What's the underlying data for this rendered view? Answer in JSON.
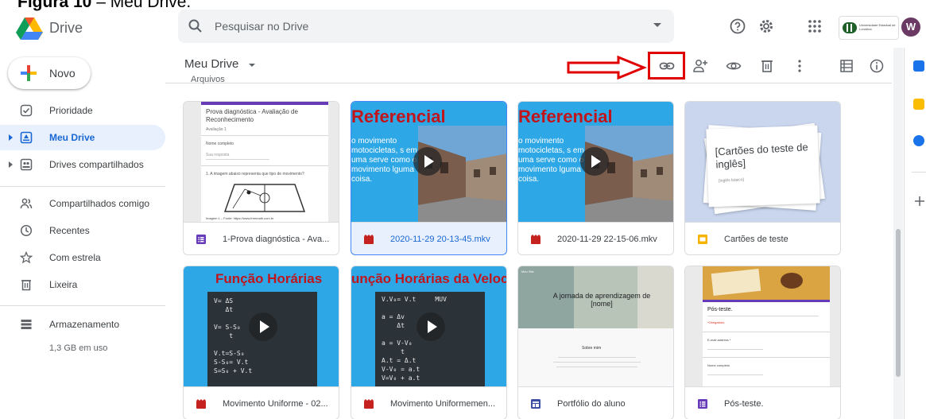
{
  "caption": {
    "label": "Figura 10",
    "text": " – Meu Drive."
  },
  "app": {
    "name": "Drive"
  },
  "search": {
    "placeholder": "Pesquisar no Drive"
  },
  "header": {
    "help_icon": "help-icon",
    "settings_icon": "gear-icon",
    "apps_icon": "apps-grid-icon",
    "avatar_initial": "W",
    "org_text": "Universidade Estadual de Londrina"
  },
  "sidebar": {
    "new_label": "Novo",
    "items": [
      {
        "label": "Prioridade",
        "icon": "priority-check-icon"
      },
      {
        "label": "Meu Drive",
        "icon": "my-drive-icon",
        "active": true
      },
      {
        "label": "Drives compartilhados",
        "icon": "shared-drives-icon"
      },
      {
        "label": "Compartilhados comigo",
        "icon": "shared-with-me-icon"
      },
      {
        "label": "Recentes",
        "icon": "clock-icon"
      },
      {
        "label": "Com estrela",
        "icon": "star-icon"
      },
      {
        "label": "Lixeira",
        "icon": "trash-icon"
      },
      {
        "label": "Armazenamento",
        "icon": "storage-icon"
      }
    ],
    "storage_used": "1,3 GB em uso"
  },
  "main": {
    "title": "Meu Drive",
    "section_heading": "Arquivos",
    "toolbar": [
      "link-icon",
      "add-person-icon",
      "preview-eye-icon",
      "trash-icon",
      "more-vert-icon",
      "list-view-icon",
      "info-icon"
    ]
  },
  "files": [
    {
      "name": "1-Prova diagnóstica - Ava...",
      "type": "form",
      "thumb": {
        "title": "Prova diagnóstica - Avaliação de Reconhecimento",
        "sub": "Avaliação 1",
        "field1": "Nome completo",
        "field2": "Sua resposta",
        "question": "1. A imagem abaixo representa que tipo de movimento?",
        "footer": "Imagem 1 – Fonte: https://www.freemath.com.br"
      }
    },
    {
      "name": "2020-11-29 20-13-45.mkv",
      "type": "video",
      "selected": true,
      "thumb": {
        "title": "Referencial",
        "text": "o movimento motocicletas, s em uma serve como o movimento lguma coisa."
      }
    },
    {
      "name": "2020-11-29 22-15-06.mkv",
      "type": "video",
      "thumb": {
        "title": "Referencial",
        "text": "o movimento motocicletas, s em uma serve como o movimento lguma coisa."
      }
    },
    {
      "name": "Cartões de teste",
      "type": "slides",
      "thumb": {
        "title": "[Cartões do teste de inglês]",
        "sub": "[Inglês básico]"
      }
    },
    {
      "name": "Movimento Uniforme - 02...",
      "type": "video",
      "thumb": {
        "title": "Função Horárias",
        "board": "V= ΔS\n   Δt\n\nV= S-S₀\n    t\n\nV.t=S-S₀\nS-S₀= V.t\nS=S₀ + V.t"
      }
    },
    {
      "name": "Movimento Uniformemen...",
      "type": "video",
      "thumb": {
        "title": "unção Horárias da Veloci",
        "board": "V.V₀= V.t     MUV\n\na = Δv\n    Δt\n\na = V-V₀\n     t\nA.t = Δ.t\nV-V₀ = a.t\nV=V₀ + a.t"
      }
    },
    {
      "name": "Portfólio do aluno",
      "type": "sites",
      "thumb": {
        "topbar": "Meu Site",
        "hero": "A jornada de aprendizagem de [nome]",
        "sub": "Sobre mim"
      }
    },
    {
      "name": "Pós-teste.",
      "type": "form",
      "thumb": {
        "title": "Pós-teste.",
        "sub": "*Obrigatório",
        "field1": "E-mail address *",
        "field2": "Nome completo"
      }
    }
  ],
  "colors": {
    "accent": "#1a73e8",
    "selected_bg": "#e8f0fe",
    "video_red": "#c5221f",
    "form_purple": "#673ab7",
    "slides_yellow": "#f4b400",
    "sites_blue": "#3c4fa3",
    "annotation_red": "#e00000"
  }
}
